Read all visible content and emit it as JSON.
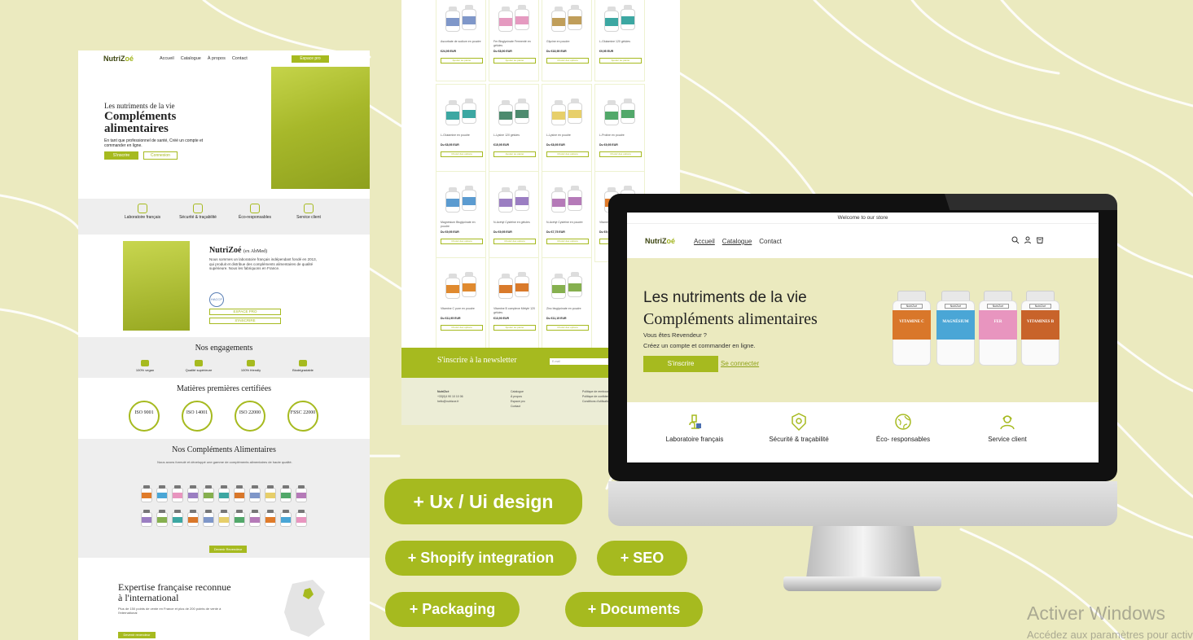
{
  "colors": {
    "accent": "#a6ba1f",
    "background": "#ebeabf",
    "dark_text": "#222222"
  },
  "landing": {
    "logo_main": "NutriZ",
    "logo_o": "oé",
    "menu": [
      "Accueil",
      "Catalogue",
      "À propos",
      "Contact"
    ],
    "pro_button": "Espace pro",
    "hero": {
      "kicker": "Les nutriments de la vie",
      "title": "Compléments alimentaires",
      "text": "En tant que professionnel de santé, Créé un compte et commander en ligne.",
      "btn_signup": "S'inscrire",
      "btn_login": "Connexion"
    },
    "features": [
      "Laboratoire français",
      "Sécurité & traçabilité",
      "Éco-responsables",
      "Service client"
    ],
    "about": {
      "title": "NutriZoé",
      "title_small": "(ex AbMed)",
      "text": "Nous sommes un laboratoire français indépendant fondé en 2013, qui produit et distribue des compléments alimentaires de qualité supérieure. Nous les fabriquons en France.",
      "badge": "HACCP",
      "btn_pro": "ESPACE PRO",
      "btn_signup": "S'INSCRIRE"
    },
    "engagements": {
      "title": "Nos engagements",
      "items": [
        "100% vegan",
        "Qualité supérieure",
        "100% friendly",
        "Biodégradable"
      ]
    },
    "matieres": {
      "title": "Matières premières certifiées",
      "badges": [
        "ISO 9001",
        "ISO 14001",
        "ISO 22000",
        "FSSC 22000"
      ]
    },
    "products": {
      "title": "Nos Compléments Alimentaires",
      "text": "Nous avons formulé et développé une gamme de compléments alimentaires de haute qualité.",
      "button": "Devenir Revendeur"
    },
    "expertise": {
      "title": "Expertise française reconnue à l'international",
      "text": "Plus de 150 points de vente en France et plus de 200 points de vente à l'international",
      "button": "Devenir revendeur"
    }
  },
  "catalogue": {
    "products": [
      {
        "name": "Ascorbate de sodium en poudre",
        "price": "€24,95 EUR",
        "button": "Ajouter au panier",
        "color": "#7f97c9"
      },
      {
        "name": "Fer Bisglycinate Fermenté en gélules",
        "price": "Du €8,90 EUR",
        "button": "Ajouter au panier",
        "color": "#e59ac0"
      },
      {
        "name": "Glycine en poudre",
        "price": "Du €18,95 EUR",
        "button": "Choisir des options",
        "color": "#c09e5a"
      },
      {
        "name": "L-Glutamine 120 gélules",
        "price": "€9,95 EUR",
        "button": "Ajouter au panier",
        "color": "#3ca7a2"
      },
      {
        "name": "L-Glutamine en poudre",
        "price": "Du €8,95 EUR",
        "button": "Choisir des options",
        "color": "#3ca7a2"
      },
      {
        "name": "L-Lysine 120 gélules",
        "price": "€15,95 EUR",
        "button": "Ajouter au panier",
        "color": "#4d8a6e"
      },
      {
        "name": "L-Lysine en poudre",
        "price": "Du €8,95 EUR",
        "button": "Choisir des options",
        "color": "#e7cf6a"
      },
      {
        "name": "L-Proline en poudre",
        "price": "Du €9,95 EUR",
        "button": "Choisir des options",
        "color": "#52a86a"
      },
      {
        "name": "Magnésium Bisglycinate en poudre",
        "price": "Du €9,95 EUR",
        "button": "Choisir des options",
        "color": "#5b9bd0"
      },
      {
        "name": "N-Acétyl Cystéine en gélules",
        "price": "Du €9,95 EUR",
        "button": "Choisir des options",
        "color": "#9b7ec2"
      },
      {
        "name": "N-Acétyl Cystéine en poudre",
        "price": "Du €7,75 EUR",
        "button": "Choisir des options",
        "color": "#b57ab8"
      },
      {
        "name": "Vitamine C",
        "price": "Du €9,95 EUR",
        "button": "Choisir des options",
        "color": "#e07b2a"
      },
      {
        "name": "Vitamine C pure en poudre",
        "price": "Du €11,95 EUR",
        "button": "Choisir des options",
        "color": "#e08a2f"
      },
      {
        "name": "Vitamine B complexe Métylé 120 gélules",
        "price": "€13,90 EUR",
        "button": "Ajouter au panier",
        "color": "#d97a2b"
      },
      {
        "name": "Zinc bisglycinate en poudre",
        "price": "Du €11,15 EUR",
        "button": "Choisir des options",
        "color": "#86b04f"
      }
    ],
    "newsletter_title": "S'inscrire à la newsletter",
    "newsletter_placeholder": "E-mail",
    "footer": {
      "brand": "NutriZoé",
      "phone": "+33(0)4 90 10 10 06",
      "email": "hello@nutrizoe.fr",
      "links": [
        "Catalogue",
        "À propos",
        "Espace pro",
        "Contact"
      ],
      "legal": [
        "Politique de remboursement",
        "Politique de confidentialité",
        "Conditions d'utilisation"
      ]
    }
  },
  "store": {
    "announcement": "Welcome to our store",
    "logo_main": "NutriZ",
    "logo_o": "oé",
    "nav": [
      "Accueil",
      "Catalogue",
      "Contact"
    ],
    "icons": [
      "search-icon",
      "account-icon",
      "cart-icon"
    ],
    "hero": {
      "kicker": "Les nutriments de la vie",
      "title": "Compléments alimentaires",
      "line1": "Vous êtes Revendeur ?",
      "line2": "Créez un compte et commander en ligne.",
      "btn_signup": "S'inscrire",
      "btn_login": "Se connecter"
    },
    "jars": [
      {
        "brand": "NutriZoé",
        "label": "VITAMINE C",
        "color": "#d9772a"
      },
      {
        "brand": "NutriZoé",
        "label": "MAGNÉSIUM",
        "color": "#4aa6d6"
      },
      {
        "brand": "NutriZoé",
        "label": "FER",
        "color": "#e895bf"
      },
      {
        "brand": "NutriZoé",
        "label": "VITAMINES B",
        "color": "#c8632a"
      }
    ],
    "features": [
      "Laboratoire français",
      "Sécurité & traçabilité",
      "Éco- responsables",
      "Service client"
    ]
  },
  "pills": {
    "ux": "+ Ux / Ui design",
    "shopify": "+ Shopify integration",
    "seo": "+ SEO",
    "packaging": "+ Packaging",
    "documents": "+ Documents"
  },
  "watermark": {
    "title": "Activer Windows",
    "subtitle": "Accédez aux paramètres pour activer Windows."
  }
}
